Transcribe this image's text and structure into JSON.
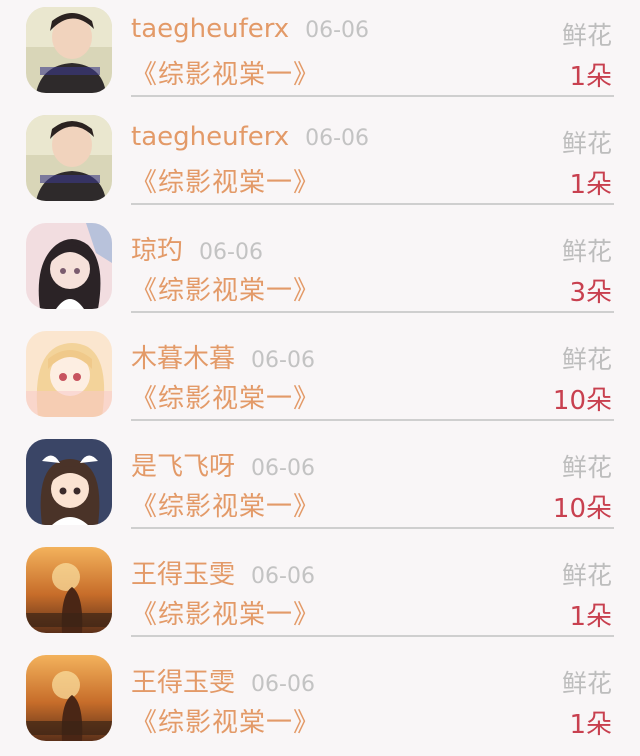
{
  "gift_list": {
    "items": [
      {
        "user": "taegheuferx",
        "date": "06-06",
        "gift": "鲜花",
        "book": "《综影视棠一》",
        "count": "1朵",
        "avatar": "avatar-photo-boy"
      },
      {
        "user": "taegheuferx",
        "date": "06-06",
        "gift": "鲜花",
        "book": "《综影视棠一》",
        "count": "1朵",
        "avatar": "avatar-photo-boy"
      },
      {
        "user": "琼玓",
        "date": "06-06",
        "gift": "鲜花",
        "book": "《综影视棠一》",
        "count": "3朵",
        "avatar": "avatar-anime-girl-dark"
      },
      {
        "user": "木暮木暮",
        "date": "06-06",
        "gift": "鲜花",
        "book": "《综影视棠一》",
        "count": "10朵",
        "avatar": "avatar-anime-girl-blonde"
      },
      {
        "user": "是飞飞呀",
        "date": "06-06",
        "gift": "鲜花",
        "book": "《综影视棠一》",
        "count": "10朵",
        "avatar": "avatar-anime-girl-bow"
      },
      {
        "user": "王得玉雯",
        "date": "06-06",
        "gift": "鲜花",
        "book": "《综影视棠一》",
        "count": "1朵",
        "avatar": "avatar-sunset-field"
      },
      {
        "user": "王得玉雯",
        "date": "06-06",
        "gift": "鲜花",
        "book": "《综影视棠一》",
        "count": "1朵",
        "avatar": "avatar-sunset-field"
      }
    ]
  }
}
